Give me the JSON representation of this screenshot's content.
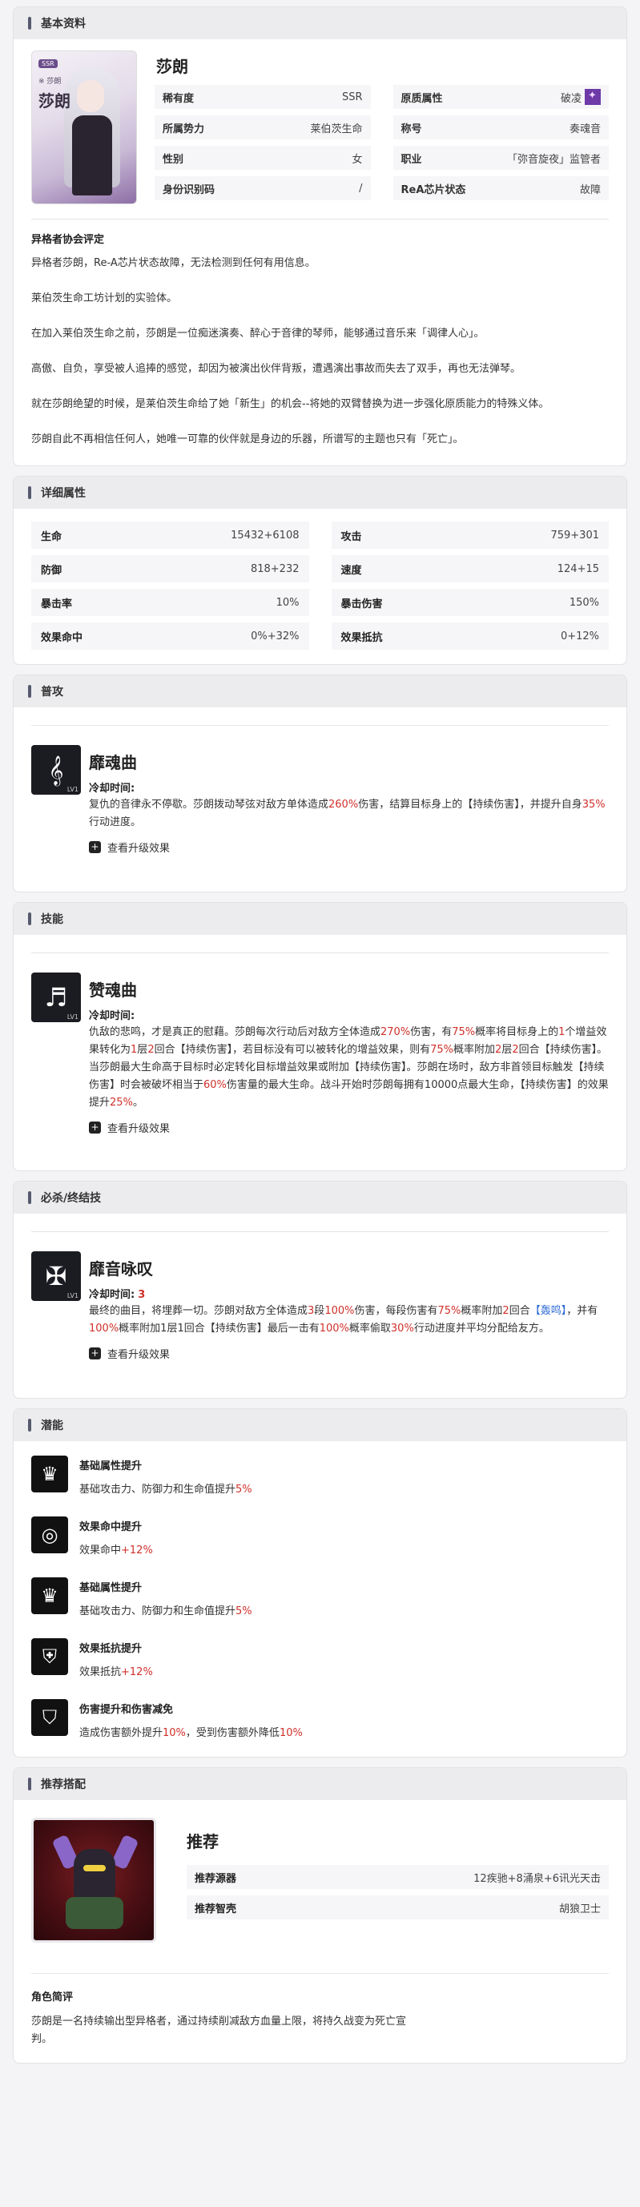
{
  "basic": {
    "header": "基本资料",
    "name": "莎朗",
    "portrait": {
      "rarity_tag": "SSR",
      "tag": "※ 莎朗",
      "name": "莎朗"
    },
    "rows": [
      {
        "key": "稀有度",
        "value": "SSR"
      },
      {
        "key": "原质属性",
        "value": "破凌",
        "icon": "purple-attribute-icon"
      },
      {
        "key": "所属势力",
        "value": "莱伯茨生命"
      },
      {
        "key": "称号",
        "value": "奏魂音"
      },
      {
        "key": "性别",
        "value": "女"
      },
      {
        "key": "职业",
        "value": "「弥音旋夜」监管者"
      },
      {
        "key": "身份识别码",
        "value": "/"
      },
      {
        "key": "ReA芯片状态",
        "value": "故障"
      }
    ],
    "eval_title": "异格者协会评定",
    "paragraphs": [
      "异格者莎朗，Re-A芯片状态故障，无法检测到任何有用信息。",
      "莱伯茨生命工坊计划的实验体。",
      "在加入莱伯茨生命之前，莎朗是一位痴迷演奏、醉心于音律的琴师，能够通过音乐来「调律人心」。",
      "高傲、自负，享受被人追捧的感觉，却因为被演出伙伴背叛，遭遇演出事故而失去了双手，再也无法弹琴。",
      "就在莎朗绝望的时候，是莱伯茨生命给了她「新生」的机会--将她的双臂替换为进一步强化原质能力的特殊义体。",
      "莎朗自此不再相信任何人，她唯一可靠的伙伴就是身边的乐器，所谱写的主题也只有「死亡」。"
    ]
  },
  "detail": {
    "header": "详细属性",
    "rows": [
      {
        "key": "生命",
        "value": "15432+6108"
      },
      {
        "key": "攻击",
        "value": "759+301"
      },
      {
        "key": "防御",
        "value": "818+232"
      },
      {
        "key": "速度",
        "value": "124+15"
      },
      {
        "key": "暴击率",
        "value": "10%"
      },
      {
        "key": "暴击伤害",
        "value": "150%"
      },
      {
        "key": "效果命中",
        "value": "0%+32%"
      },
      {
        "key": "效果抵抗",
        "value": "0+12%"
      }
    ]
  },
  "normal": {
    "header": "普攻",
    "name": "靡魂曲",
    "icon": "music-note-icon",
    "cd_label": "冷却时间:",
    "cd_value": "",
    "desc": [
      {
        "t": "复仇的音律永不停歇。莎朗拨动琴弦对敌方单体造成"
      },
      {
        "t": "260%",
        "h": true
      },
      {
        "t": "伤害，结算目标身上的【持续伤害】，并提升自身"
      },
      {
        "t": "35%",
        "h": true
      },
      {
        "t": "行动进度。"
      }
    ],
    "upgrade": "查看升级效果"
  },
  "skill": {
    "header": "技能",
    "name": "赞魂曲",
    "icon": "treble-clef-icon",
    "cd_label": "冷却时间:",
    "cd_value": "",
    "desc": [
      {
        "t": "仇敌的悲鸣，才是真正的慰藉。莎朗每次行动后对敌方全体造成"
      },
      {
        "t": "270%",
        "h": true
      },
      {
        "t": "伤害，有"
      },
      {
        "t": "75%",
        "h": true
      },
      {
        "t": "概率将目标身上的"
      },
      {
        "t": "1",
        "h": true
      },
      {
        "t": "个增益效果转化为"
      },
      {
        "t": "1",
        "h": true
      },
      {
        "t": "层"
      },
      {
        "t": "2",
        "h": true
      },
      {
        "t": "回合【持续伤害】，若目标没有可以被转化的增益效果，则有"
      },
      {
        "t": "75%",
        "h": true
      },
      {
        "t": "概率附加"
      },
      {
        "t": "2",
        "h": true
      },
      {
        "t": "层"
      },
      {
        "t": "2",
        "h": true
      },
      {
        "t": "回合【持续伤害】。当莎朗最大生命高于目标时必定转化目标增益效果或附加【持续伤害】。莎朗在场时，敌方非首领目标触发【持续伤害】时会被破坏相当于"
      },
      {
        "t": "60%",
        "h": true
      },
      {
        "t": "伤害量的最大生命。战斗开始时莎朗每拥有10000点最大生命，【持续伤害】的效果提升"
      },
      {
        "t": "25%",
        "h": true
      },
      {
        "t": "。"
      }
    ],
    "upgrade": "查看升级效果"
  },
  "ultimate": {
    "header": "必杀/终结技",
    "name": "靡音咏叹",
    "icon": "hand-cross-icon",
    "cd_label": "冷却时间:",
    "cd_value": "3",
    "desc": [
      {
        "t": "最终的曲目，将埋葬一切。莎朗对敌方全体造成"
      },
      {
        "t": "3",
        "h": true
      },
      {
        "t": "段"
      },
      {
        "t": "100%",
        "h": true
      },
      {
        "t": "伤害，每段伤害有"
      },
      {
        "t": "75%",
        "h": true
      },
      {
        "t": "概率附加"
      },
      {
        "t": "2",
        "h": true
      },
      {
        "t": "回合"
      },
      {
        "t": "【轰鸣】",
        "b": true
      },
      {
        "t": "，并有"
      },
      {
        "t": "100%",
        "h": true
      },
      {
        "t": "概率附加1层1回合【持续伤害】最后一击有"
      },
      {
        "t": "100%",
        "h": true
      },
      {
        "t": "概率偷取"
      },
      {
        "t": "30%",
        "h": true
      },
      {
        "t": "行动进度并平均分配给友方。"
      }
    ],
    "upgrade": "查看升级效果"
  },
  "potential": {
    "header": "潜能",
    "items": [
      {
        "name": "基础属性提升",
        "icon": "crown-icon",
        "desc": [
          {
            "t": "基础攻击力、防御力和生命值提升"
          },
          {
            "t": "5%",
            "h": true
          }
        ]
      },
      {
        "name": "效果命中提升",
        "icon": "target-icon",
        "desc": [
          {
            "t": "效果命中"
          },
          {
            "t": "+12%",
            "h": true
          }
        ]
      },
      {
        "name": "基础属性提升",
        "icon": "crown-icon",
        "desc": [
          {
            "t": "基础攻击力、防御力和生命值提升"
          },
          {
            "t": "5%",
            "h": true
          }
        ]
      },
      {
        "name": "效果抵抗提升",
        "icon": "shield-break-icon",
        "desc": [
          {
            "t": "效果抵抗"
          },
          {
            "t": "+12%",
            "h": true
          }
        ]
      },
      {
        "name": "伤害提升和伤害减免",
        "icon": "shield-icon",
        "desc": [
          {
            "t": "造成伤害额外提升"
          },
          {
            "t": "10%",
            "h": true
          },
          {
            "t": "，受到伤害额外降低"
          },
          {
            "t": "10%",
            "h": true
          }
        ]
      }
    ]
  },
  "recommend": {
    "header": "推荐搭配",
    "title": "推荐",
    "rows": [
      {
        "key": "推荐源器",
        "value": "12疾驰+8涌泉+6讯光天击"
      },
      {
        "key": "推荐智壳",
        "value": "胡狼卫士"
      }
    ],
    "eval_title": "角色简评",
    "eval_desc": "莎朗是一名持续输出型异格者，通过持续削减敌方血量上限，将持久战变为死亡宣判。"
  }
}
